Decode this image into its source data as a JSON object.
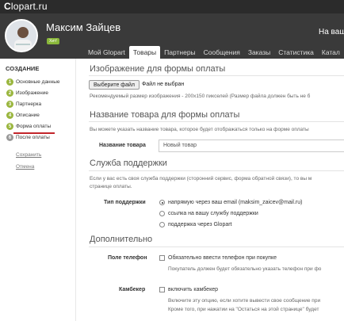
{
  "topbar": {
    "logo_first": "C",
    "logo_rest": "lopart.ru"
  },
  "header": {
    "username": "Максим Зайцев",
    "badge": "Хит!",
    "right_text": "На ваш"
  },
  "tabs": [
    {
      "label": "Мой Glopart",
      "active": false
    },
    {
      "label": "Товары",
      "active": true
    },
    {
      "label": "Партнеры",
      "active": false
    },
    {
      "label": "Сообщения",
      "active": false
    },
    {
      "label": "Заказы",
      "active": false
    },
    {
      "label": "Статистика",
      "active": false
    },
    {
      "label": "Катал",
      "active": false
    }
  ],
  "sidebar": {
    "title": "СОЗДАНИЕ",
    "items": [
      {
        "num": "1",
        "label": "Основные данные",
        "state": "done"
      },
      {
        "num": "2",
        "label": "Изображение",
        "state": "done"
      },
      {
        "num": "3",
        "label": "Партнерка",
        "state": "done"
      },
      {
        "num": "4",
        "label": "Описание",
        "state": "done"
      },
      {
        "num": "5",
        "label": "Форма оплаты",
        "state": "current"
      },
      {
        "num": "6",
        "label": "После оплаты",
        "state": "todo"
      }
    ],
    "save_link": "Сохранить",
    "cancel_link": "Отмена"
  },
  "image_section": {
    "title": "Изображение для формы оплаты",
    "button": "Выберите файл",
    "file_status": "Файл не выбран",
    "hint": "Рекомендуемый размер изображения - 200x150 пикселей (Размер файла должен быть не б"
  },
  "name_section": {
    "title": "Название товара для формы оплаты",
    "hint": "Вы можете указать название товара, которое будет отображаться только на форме оплаты",
    "label": "Название товара",
    "value": "Новый товар"
  },
  "support_section": {
    "title": "Служба поддержки",
    "hint1": "Если у вас есть своя служба поддержки (сторонний сервис, форма обратной связи), то вы м",
    "hint2": "странице оплаты.",
    "label": "Тип поддержки",
    "options": [
      {
        "label": "напрямую через ваш email (maksim_zaicev@mail.ru)",
        "selected": true
      },
      {
        "label": "ссылка на вашу службу поддержки",
        "selected": false
      },
      {
        "label": "поддержка через Glopart",
        "selected": false
      }
    ]
  },
  "extra_section": {
    "title": "Дополнительно",
    "phone_label": "Поле телефон",
    "phone_check": "Обязательно ввести телефон при покупке",
    "phone_hint": "Покупатель должен будет обязательно указать телефон при фо",
    "cashback_label": "Камбекер",
    "cashback_check": "включить камбекер",
    "cashback_hint1": "Включите эту опцию, если хотите вывести свое сообщение при",
    "cashback_hint2": "Кроме того, при нажатии на \"Остаться на этой странице\" будет"
  },
  "colors": {
    "accent": "#9ab63e",
    "header_bg": "#3a3a3a",
    "topbar_bg": "#2b2b2b",
    "underline": "#c2252b"
  }
}
